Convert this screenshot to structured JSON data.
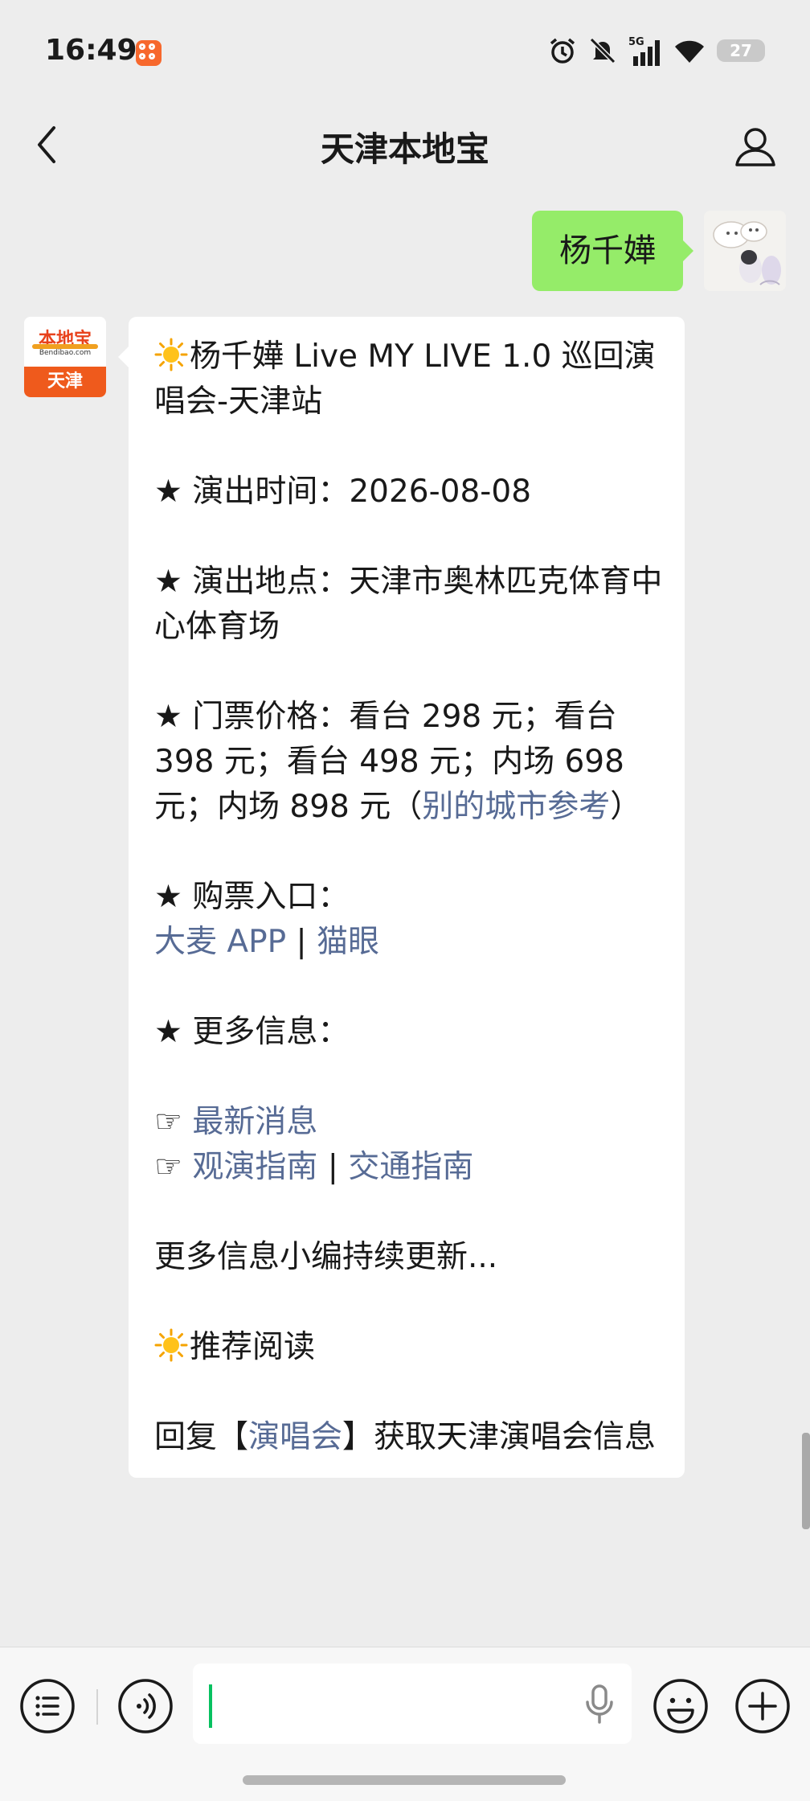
{
  "status_bar": {
    "time": "16:49",
    "battery": "27",
    "network": "5G",
    "icons": [
      "app-notification-icon",
      "alarm-icon",
      "mute-icon",
      "signal-icon",
      "wifi-icon",
      "battery-icon"
    ]
  },
  "header": {
    "title": "天津本地宝",
    "back_icon": "chevron-left-icon",
    "profile_icon": "person-icon"
  },
  "chat": {
    "outgoing": {
      "text": "杨千嬅",
      "avatar": "cartoon-cat-avatar"
    },
    "account_avatar": {
      "logo_text": "本地宝",
      "logo_url": "Bendibao.com",
      "city": "天津"
    },
    "reply": {
      "title": "杨千嬅 Live MY LIVE 1.0 巡回演唱会-天津站",
      "time": "★ 演出时间：2026-08-08",
      "venue": "★ 演出地点：天津市奥林匹克体育中心体育场",
      "price_text": "★ 门票价格：看台 298 元；看台 398 元；看台 498 元；内场 698 元；内场 898 元（",
      "price_link": "别的城市参考",
      "price_close": "）",
      "ticket_heading": "★ 购票入口：",
      "ticket_link_1": "大麦 APP",
      "separator": " | ",
      "ticket_link_2": "猫眼",
      "more_heading": "★ 更多信息：",
      "pointer": "☞ ",
      "news_link": "最新消息",
      "guide_link": "观演指南",
      "traffic_link": "交通指南",
      "updating": "更多信息小编持续更新...",
      "recommend": "推荐阅读",
      "reply_prefix": "回复【",
      "reply_link": "演唱会",
      "reply_suffix": "】获取天津演唱会信息"
    }
  },
  "input_bar": {
    "icons": [
      "list-menu-icon",
      "voice-icon",
      "mic-icon",
      "emoji-icon",
      "plus-icon"
    ]
  },
  "colors": {
    "background": "#ededed",
    "outgoing_bubble": "#95ec69",
    "link": "#576b95",
    "accent": "#07c160"
  }
}
